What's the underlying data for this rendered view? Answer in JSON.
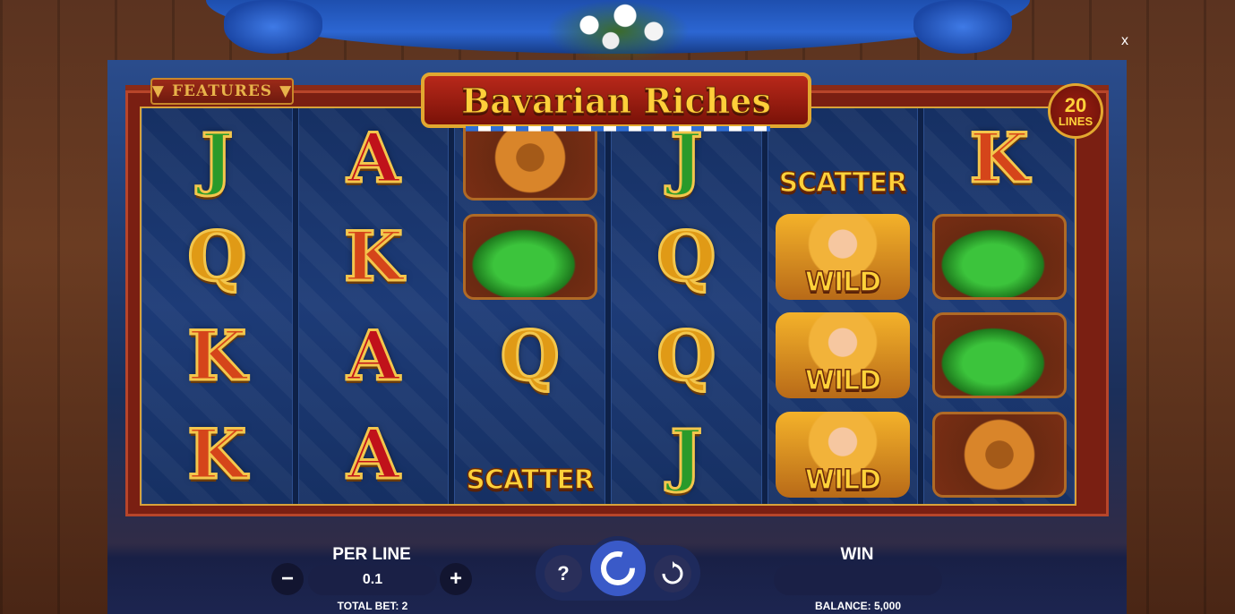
{
  "window": {
    "close_label": "x"
  },
  "header": {
    "features_label": "FEATURES",
    "title": "Bavarian Riches",
    "lines_count": "20",
    "lines_label": "LINES"
  },
  "reels": [
    [
      "J",
      "Q",
      "K",
      "K"
    ],
    [
      "A",
      "K",
      "A",
      "A"
    ],
    [
      "pretzel",
      "hat",
      "Q",
      "scatter"
    ],
    [
      "J",
      "Q",
      "Q",
      "J"
    ],
    [
      "scatter",
      "wild",
      "wild",
      "wild"
    ],
    [
      "K",
      "hat",
      "hat",
      "pretzel"
    ]
  ],
  "symbol_labels": {
    "scatter": "SCATTER",
    "wild": "WILD"
  },
  "controls": {
    "per_line_label": "PER LINE",
    "per_line_value": "0.1",
    "minus_label": "−",
    "plus_label": "+",
    "total_bet_label": "TOTAL BET: 2",
    "help_label": "?",
    "win_label": "WIN",
    "win_value": "",
    "balance_label": "BALANCE: 5,000"
  },
  "colors": {
    "frame_red": "#7a1f12",
    "gold": "#e2a830",
    "reel_blue": "#163063",
    "spin_blue": "#3a5ac8"
  }
}
